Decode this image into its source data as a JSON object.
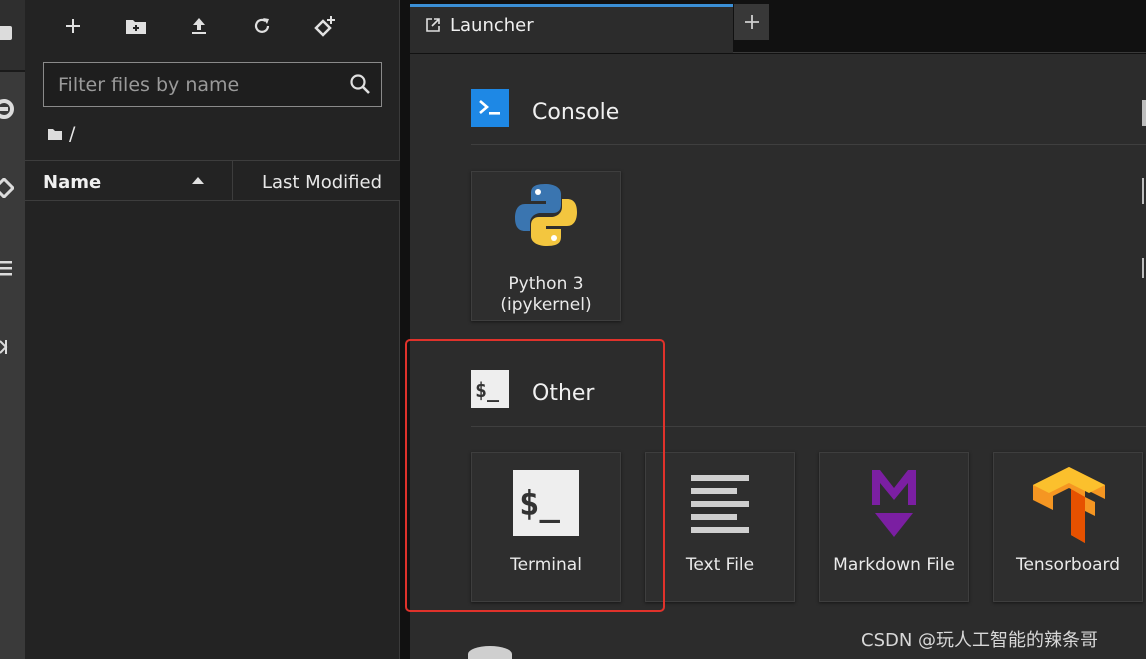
{
  "filebrowser": {
    "filter_placeholder": "Filter files by name",
    "breadcrumb": "/",
    "columns": {
      "name": "Name",
      "modified": "Last Modified"
    }
  },
  "tabs": [
    {
      "label": "Launcher"
    }
  ],
  "launcher": {
    "console": {
      "title": "Console",
      "items": [
        {
          "label": "Python 3",
          "sublabel": "(ipykernel)"
        }
      ]
    },
    "other": {
      "title": "Other",
      "items": [
        {
          "label": "Terminal"
        },
        {
          "label": "Text File"
        },
        {
          "label": "Markdown File"
        },
        {
          "label": "Tensorboard"
        }
      ]
    }
  },
  "watermark": "CSDN @玩人工智能的辣条哥",
  "colors": {
    "accent": "#3b8fd6",
    "highlight": "#e0322b",
    "console_icon": "#1e88e5",
    "markdown": "#7b1fa2",
    "tensorflow": "#f57c00"
  }
}
